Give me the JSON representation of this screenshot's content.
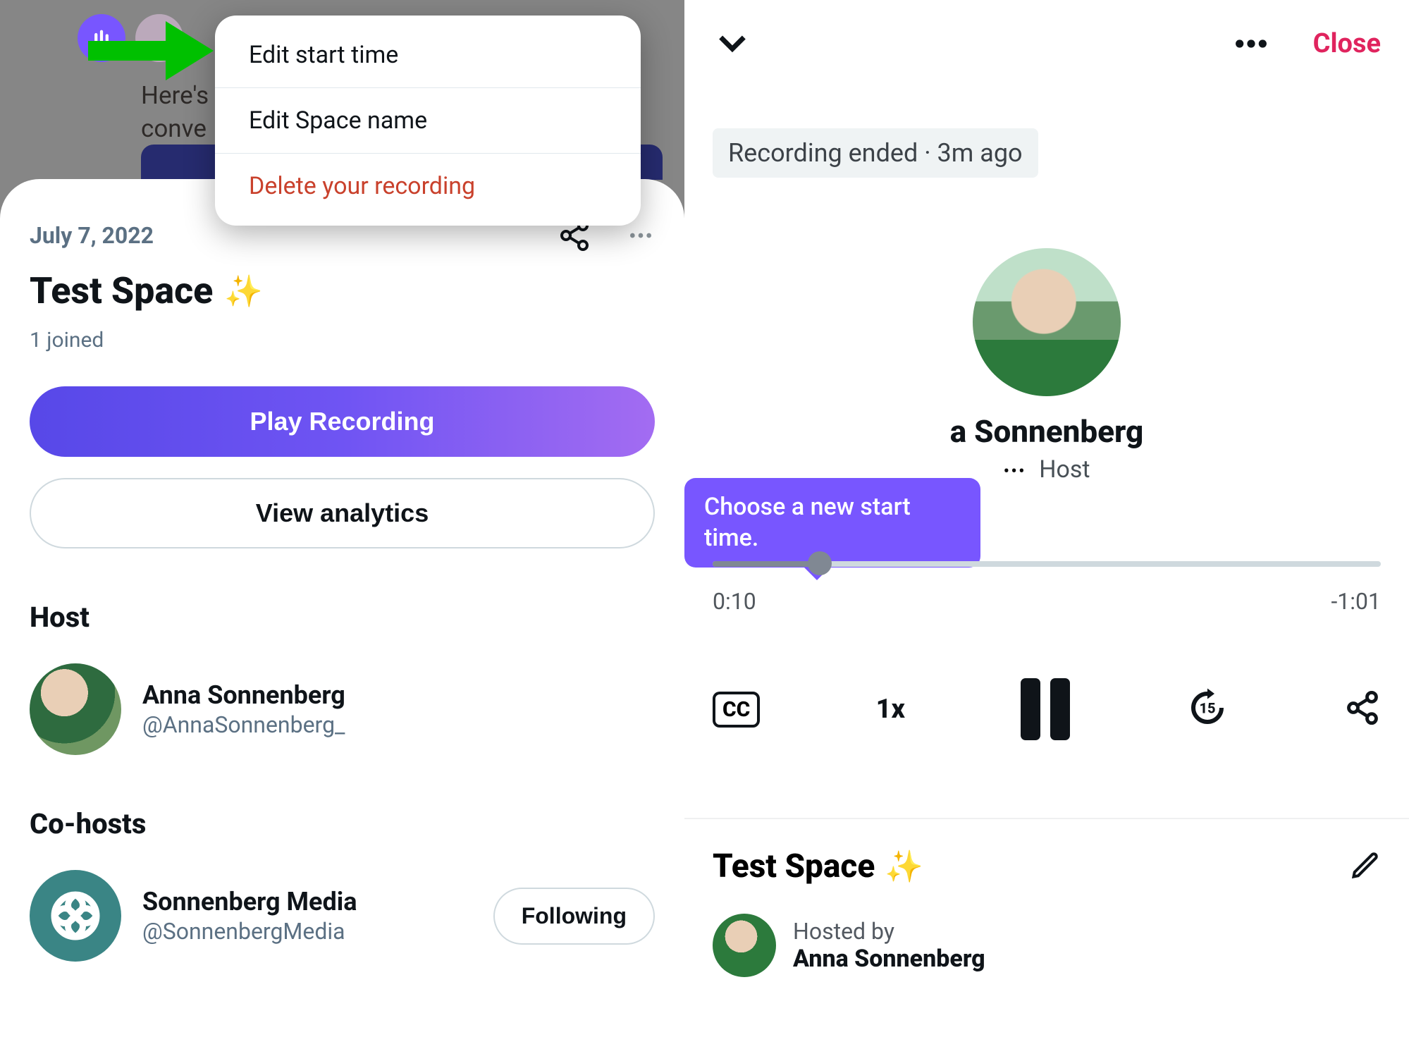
{
  "left": {
    "background_text_line1": "Here's",
    "background_text_line2": "conve",
    "menu": {
      "edit_start": "Edit start time",
      "edit_name": "Edit Space name",
      "delete": "Delete your recording"
    },
    "date": "July 7, 2022",
    "space_title": "Test Space",
    "joined": "1 joined",
    "play_label": "Play Recording",
    "analytics_label": "View analytics",
    "host_section": "Host",
    "host_name": "Anna Sonnenberg",
    "host_handle": "@AnnaSonnenberg_",
    "cohosts_section": "Co-hosts",
    "cohost_name": "Sonnenberg Media",
    "cohost_handle": "@SonnenbergMedia",
    "following_label": "Following"
  },
  "right": {
    "close_label": "Close",
    "status_badge": "Recording ended · 3m ago",
    "host_partial_name": "a Sonnenberg",
    "host_role": "Host",
    "tooltip": "Choose a new start time.",
    "time_current": "0:10",
    "time_remaining": "-1:01",
    "cc_label": "CC",
    "speed_label": "1x",
    "skip_seconds": "15",
    "space_title": "Test Space",
    "hosted_by": "Hosted by",
    "host_name": "Anna Sonnenberg"
  }
}
